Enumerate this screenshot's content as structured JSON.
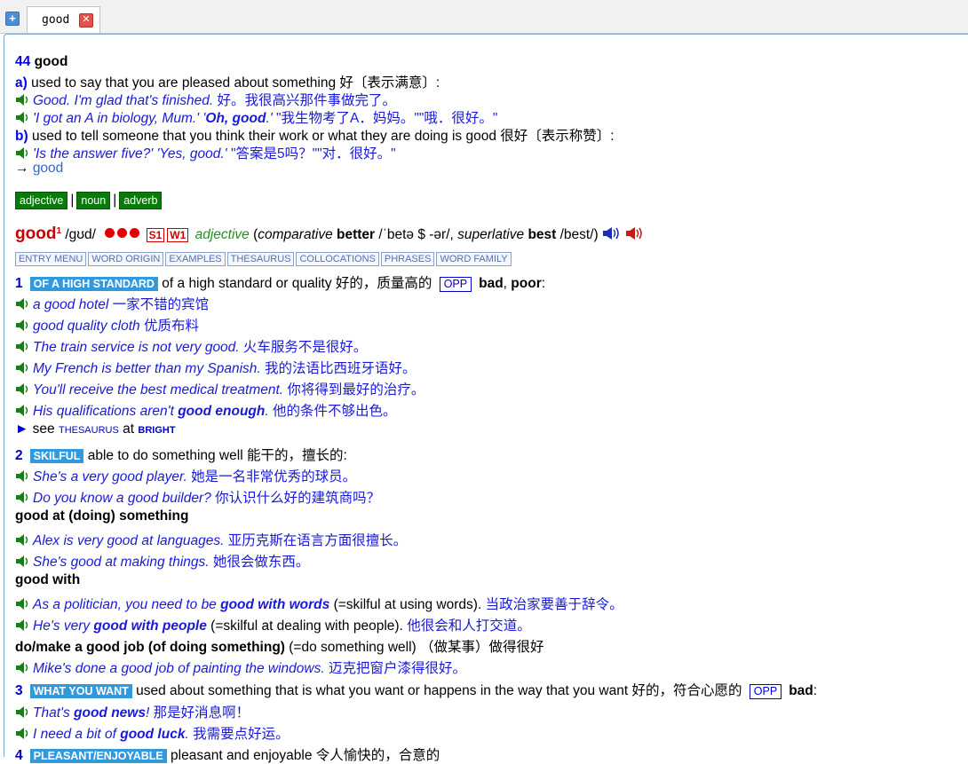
{
  "tab": {
    "label": "good"
  },
  "entry44": {
    "num": "44",
    "word": "good",
    "a_label": "a)",
    "a_def": "used to say that you are pleased about something 好〔表示满意〕:",
    "ex1": "Good. I'm glad that's finished.",
    "ex1_zh": "好。我很高兴那件事做完了。",
    "ex2a": "'I got an A in biology, Mum.' '",
    "ex2b": "Oh, good",
    "ex2c": ".'",
    "ex2_zh": "\"我生物考了A．妈妈。\"\"哦．很好。\"",
    "b_label": "b)",
    "b_def": "used to tell someone that you think their work or what they are doing is good 很好〔表示称赞〕:",
    "ex3": "'Is the answer five?' 'Yes, good.'",
    "ex3_zh": "\"答案是5吗？\"\"对．很好。\"",
    "see_arrow": "→",
    "see_link": "good"
  },
  "pos_tabs": [
    "adjective",
    "noun",
    "adverb"
  ],
  "pos_sep": "|",
  "headword": {
    "word": "good",
    "sup": "1",
    "pron": "/ɡʊd/",
    "s_badge": "S1",
    "w_badge": "W1",
    "pos": "adjective",
    "comp_label": "comparative",
    "comp_word": "better",
    "comp_pron": "/ˈbetə $ -ər/,",
    "sup_label": "superlative",
    "sup_word": "best",
    "sup_pron": "/best/)"
  },
  "nav_buttons": [
    "ENTRY MENU",
    "WORD ORIGIN",
    "EXAMPLES",
    "THESAURUS",
    "COLLOCATIONS",
    "PHRASES",
    "WORD FAMILY"
  ],
  "sense1": {
    "num": "1",
    "label": "OF A HIGH STANDARD",
    "def": "of a high standard or quality 好的，质量高的",
    "opp": "OPP",
    "opp_words": "bad",
    "opp_words2": "poor",
    "opp_end": ":",
    "comma": ",",
    "examples": [
      {
        "en": "a good hotel",
        "zh": "一家不错的宾馆"
      },
      {
        "en": "good quality cloth",
        "zh": "优质布料"
      },
      {
        "en": "The train service is not very good.",
        "zh": "火车服务不是很好。"
      },
      {
        "en": "My French is better than my Spanish.",
        "zh": "我的法语比西班牙语好。"
      },
      {
        "en": "You'll receive the best medical treatment.",
        "zh": "你将得到最好的治疗。"
      }
    ],
    "ex6a": "His qualifications aren't ",
    "ex6b": "good enough",
    "ex6c": ".",
    "ex6_zh": "他的条件不够出色。",
    "see_marker": "►",
    "see_text": "see",
    "see_thes": "THESAURUS",
    "see_at": "at",
    "see_bright": "BRIGHT"
  },
  "sense2": {
    "num": "2",
    "label": "SKILFUL",
    "def": "able to do something well 能干的，擅长的:",
    "ex1": "She's a very good player.",
    "ex1_zh": "她是一名非常优秀的球员。",
    "ex2": "Do you know a good builder?",
    "ex2_zh": "你认识什么好的建筑商吗？",
    "phrase1": "good at (doing) something",
    "ex3": "Alex is very good at languages.",
    "ex3_zh": "亚历克斯在语言方面很擅长。",
    "ex4": "She's good at making things.",
    "ex4_zh": "她很会做东西。",
    "phrase2": "good with",
    "ex5a": "As a politician, you need to be ",
    "ex5b": "good with words",
    "ex5c": "(=skilful at using words).",
    "ex5_zh": "当政治家要善于辞令。",
    "ex6a": "He's very ",
    "ex6b": "good with people",
    "ex6c": "(=skilful at dealing with people).",
    "ex6_zh": "他很会和人打交道。",
    "phrase3": "do/make a good job (of doing something)",
    "phrase3_def": "(=do something well) （做某事）做得很好",
    "ex7": "Mike's done a good job of painting the windows.",
    "ex7_zh": "迈克把窗户漆得很好。"
  },
  "sense3": {
    "num": "3",
    "label": "WHAT YOU WANT",
    "def": "used about something that is what you want or happens in the way that you want 好的，符合心愿的",
    "opp": "OPP",
    "opp_words": "bad",
    "opp_end": ":",
    "ex1a": "That's ",
    "ex1b": "good news",
    "ex1c": "!",
    "ex1_zh": "那是好消息啊！",
    "ex2a": "I need a bit of ",
    "ex2b": "good luck",
    "ex2c": ".",
    "ex2_zh": "我需要点好运。"
  },
  "sense4": {
    "num": "4",
    "label": "PLEASANT/ENJOYABLE",
    "def": "pleasant and enjoyable 令人愉快的，合意的"
  }
}
